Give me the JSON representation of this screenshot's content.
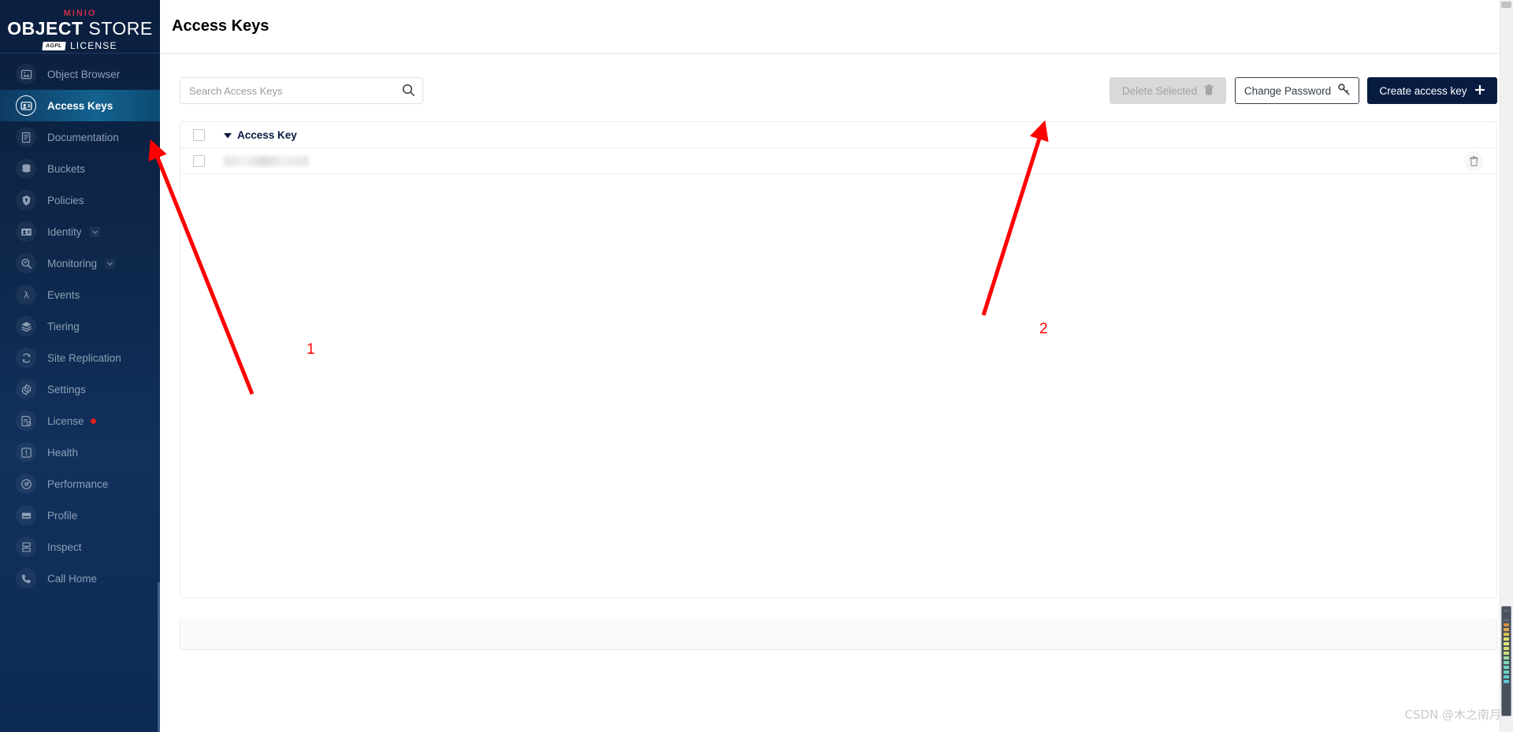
{
  "brand": {
    "minio": "MINIO",
    "product_bold": "OBJECT",
    "product_light": "STORE",
    "badge": "AGPL",
    "license_label": "LICENSE"
  },
  "sidebar": {
    "items": [
      {
        "label": "Object Browser",
        "icon": "object-browser-icon",
        "active": false,
        "chevron": false,
        "dot": false
      },
      {
        "label": "Access Keys",
        "icon": "access-keys-icon",
        "active": true,
        "chevron": false,
        "dot": false
      },
      {
        "label": "Documentation",
        "icon": "documentation-icon",
        "active": false,
        "chevron": false,
        "dot": false
      },
      {
        "label": "Buckets",
        "icon": "buckets-icon",
        "active": false,
        "chevron": false,
        "dot": false
      },
      {
        "label": "Policies",
        "icon": "policies-icon",
        "active": false,
        "chevron": false,
        "dot": false
      },
      {
        "label": "Identity",
        "icon": "identity-icon",
        "active": false,
        "chevron": true,
        "dot": false
      },
      {
        "label": "Monitoring",
        "icon": "monitoring-icon",
        "active": false,
        "chevron": true,
        "dot": false
      },
      {
        "label": "Events",
        "icon": "events-lambda-icon",
        "active": false,
        "chevron": false,
        "dot": false
      },
      {
        "label": "Tiering",
        "icon": "tiering-layers-icon",
        "active": false,
        "chevron": false,
        "dot": false
      },
      {
        "label": "Site Replication",
        "icon": "site-replication-icon",
        "active": false,
        "chevron": false,
        "dot": false
      },
      {
        "label": "Settings",
        "icon": "gear-icon",
        "active": false,
        "chevron": false,
        "dot": false
      },
      {
        "label": "License",
        "icon": "license-icon",
        "active": false,
        "chevron": false,
        "dot": true
      },
      {
        "label": "Health",
        "icon": "health-icon",
        "active": false,
        "chevron": false,
        "dot": false
      },
      {
        "label": "Performance",
        "icon": "performance-icon",
        "active": false,
        "chevron": false,
        "dot": false
      },
      {
        "label": "Profile",
        "icon": "profile-icon",
        "active": false,
        "chevron": false,
        "dot": false
      },
      {
        "label": "Inspect",
        "icon": "inspect-icon",
        "active": false,
        "chevron": false,
        "dot": false
      },
      {
        "label": "Call Home",
        "icon": "call-home-phone-icon",
        "active": false,
        "chevron": false,
        "dot": false
      }
    ]
  },
  "header": {
    "title": "Access Keys"
  },
  "search": {
    "placeholder": "Search Access Keys",
    "value": "",
    "icon": "search-icon"
  },
  "toolbar": {
    "delete_selected_label": "Delete Selected",
    "delete_selected_icon": "trash-icon",
    "delete_selected_disabled": true,
    "change_password_label": "Change Password",
    "change_password_icon": "key-icon",
    "create_key_label": "Create access key",
    "create_key_icon": "plus-icon"
  },
  "table": {
    "select_all_checked": false,
    "sort_direction_icon": "caret-down-icon",
    "columns": [
      "Access Key"
    ],
    "rows": [
      {
        "checked": false,
        "access_key": "",
        "redacted": true,
        "delete_icon": "trash-icon"
      }
    ]
  },
  "annotations": [
    {
      "id": "1",
      "label": "1"
    },
    {
      "id": "2",
      "label": "2"
    }
  ],
  "watermark": {
    "text": "CSDN @木之南月"
  },
  "colors": {
    "sidebar_bg": "#0d2547",
    "accent_active": "#13628f",
    "brand_red": "#c72c48",
    "primary_button": "#081c42",
    "annotation_red": "#ff0000",
    "license_dot": "#e02020"
  }
}
